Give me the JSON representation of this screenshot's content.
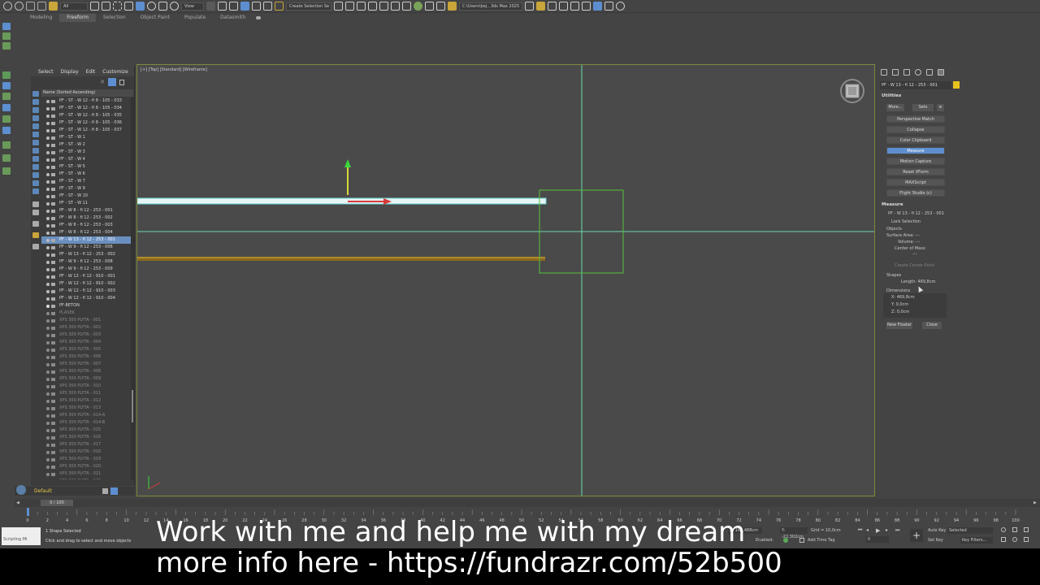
{
  "toolbar": {
    "selection_filter": "All",
    "view_dropdown": "View",
    "named_selection": "Create Selection Se",
    "project_path": "C:\\Users\\bej...3ds Max 2025"
  },
  "ribbon_tabs": [
    "Modeling",
    "Freeform",
    "Selection",
    "Object Paint",
    "Populate",
    "Datasmith"
  ],
  "ribbon_active": "Freeform",
  "explorer": {
    "menu": [
      "Select",
      "Display",
      "Edit",
      "Customize"
    ],
    "column_header": "Name (Sorted Ascending)",
    "rows": [
      {
        "name": "PF - ST - W 12 - fi 8 - 105 - 033",
        "state": "normal"
      },
      {
        "name": "PF - ST - W 12 - fi 8 - 105 - 034",
        "state": "normal"
      },
      {
        "name": "PF - ST - W 12 - fi 8 - 105 - 035",
        "state": "normal"
      },
      {
        "name": "PF - ST - W 12 - fi 8 - 105 - 036",
        "state": "normal"
      },
      {
        "name": "PF - ST - W 12 - fi 8 - 105 - 037",
        "state": "normal"
      },
      {
        "name": "PF - ST - W 1",
        "state": "normal"
      },
      {
        "name": "PF - ST - W 2",
        "state": "normal"
      },
      {
        "name": "PF - ST - W 3",
        "state": "normal"
      },
      {
        "name": "PF - ST - W 4",
        "state": "normal"
      },
      {
        "name": "PF - ST - W 5",
        "state": "normal"
      },
      {
        "name": "PF - ST - W 6",
        "state": "normal"
      },
      {
        "name": "PF - ST - W 7",
        "state": "normal"
      },
      {
        "name": "PF - ST - W 9",
        "state": "normal"
      },
      {
        "name": "PF - ST - W 10",
        "state": "normal"
      },
      {
        "name": "PF - ST - W 11",
        "state": "normal"
      },
      {
        "name": "PF - W 8 - fi 12 - 253 - 001",
        "state": "normal"
      },
      {
        "name": "PF - W 8 - fi 12 - 253 - 002",
        "state": "normal"
      },
      {
        "name": "PF - W 8 - fi 12 - 253 - 003",
        "state": "normal"
      },
      {
        "name": "PF - W 8 - fi 12 - 253 - 004",
        "state": "normal"
      },
      {
        "name": "PF - W 13 - fi 12 - 253 - 001",
        "state": "selected"
      },
      {
        "name": "PF - W 9 - fi 12 - 253 - 006",
        "state": "normal"
      },
      {
        "name": "PF - W 13 - fi 12 - 253 - 002",
        "state": "normal"
      },
      {
        "name": "PF - W 9 - fi 12 - 253 - 008",
        "state": "normal"
      },
      {
        "name": "PF - W 9 - fi 12 - 253 - 009",
        "state": "normal"
      },
      {
        "name": "PF - W 12 - fi 12 - 910 - 001",
        "state": "normal"
      },
      {
        "name": "PF - W 12 - fi 12 - 910 - 002",
        "state": "normal"
      },
      {
        "name": "PF - W 12 - fi 12 - 910 - 003",
        "state": "normal"
      },
      {
        "name": "PF - W 12 - fi 12 - 910 - 004",
        "state": "normal"
      },
      {
        "name": "PF-BETON",
        "state": "layer"
      },
      {
        "name": "PLASEK",
        "state": "dim"
      },
      {
        "name": "XPS 300 PLYTA - 001",
        "state": "dim"
      },
      {
        "name": "XPS 300 PLYTA - 002",
        "state": "dim"
      },
      {
        "name": "XPS 300 PLYTA - 003",
        "state": "dim"
      },
      {
        "name": "XPS 300 PLYTA - 004",
        "state": "dim"
      },
      {
        "name": "XPS 300 PLYTA - 005",
        "state": "dim"
      },
      {
        "name": "XPS 300 PLYTA - 006",
        "state": "dim"
      },
      {
        "name": "XPS 300 PLYTA - 007",
        "state": "dim"
      },
      {
        "name": "XPS 300 PLYTA - 008",
        "state": "dim"
      },
      {
        "name": "XPS 300 PLYTA - 009",
        "state": "dim"
      },
      {
        "name": "XPS 300 PLYTA - 010",
        "state": "dim"
      },
      {
        "name": "XPS 300 PLYTA - 011",
        "state": "dim"
      },
      {
        "name": "XPS 300 PLYTA - 012",
        "state": "dim"
      },
      {
        "name": "XPS 300 PLYTA - 013",
        "state": "dim"
      },
      {
        "name": "XPS 300 PLYTA - 014-A",
        "state": "dim"
      },
      {
        "name": "XPS 300 PLYTA - 014-B",
        "state": "dim"
      },
      {
        "name": "XPS 300 PLYTA - 015",
        "state": "dim"
      },
      {
        "name": "XPS 300 PLYTA - 016",
        "state": "dim"
      },
      {
        "name": "XPS 300 PLYTA - 017",
        "state": "dim"
      },
      {
        "name": "XPS 300 PLYTA - 018",
        "state": "dim"
      },
      {
        "name": "XPS 300 PLYTA - 019",
        "state": "dim"
      },
      {
        "name": "XPS 300 PLYTA - 020",
        "state": "dim"
      },
      {
        "name": "XPS 300 PLYTA - 021",
        "state": "dim"
      },
      {
        "name": "XPS 300 PLYTA - 022",
        "state": "dim"
      }
    ],
    "layer": "Default"
  },
  "viewport": {
    "label": "[+] [Top] [Standard] [Wireframe]"
  },
  "command_panel": {
    "object_name": "PF - W 13 - fi 12 - 253 - 001",
    "object_color": "#e8c21c",
    "utilities_title": "Utilities",
    "more_label": "More...",
    "sets_label": "Sets",
    "utility_buttons": [
      "Perspective Match",
      "Collapse",
      "Color Clipboard",
      "Measure",
      "Motion Capture",
      "Reset XForm",
      "MAXScript",
      "Flight Studio (c)"
    ],
    "active_utility": "Measure",
    "measure": {
      "title": "Measure",
      "object": "PF - W 13 - fi 12 - 253 - 001",
      "lock_selection": "Lock Selection",
      "objects_label": "Objects",
      "surface_area": "Surface Area: ---",
      "volume": "Volume: ---",
      "center_of_mass": "Center of Mass:",
      "center_value": "---",
      "create_center_point": "Create Center Point",
      "shapes_label": "Shapes",
      "length": "Length: 469,8cm",
      "dimensions_label": "Dimensions",
      "dim_x": "X:  469,8cm",
      "dim_y": "Y:  0,0cm",
      "dim_z": "Z:  0,0cm",
      "new_floater": "New Floater",
      "close": "Close"
    }
  },
  "timeline": {
    "frame": "0 / 100",
    "ticks": [
      "0",
      "2",
      "4",
      "6",
      "8",
      "10",
      "12",
      "14",
      "16",
      "18",
      "20",
      "22",
      "24",
      "26",
      "28",
      "30",
      "32",
      "34",
      "36",
      "38",
      "40",
      "42",
      "44",
      "46",
      "48",
      "50",
      "52",
      "54",
      "56",
      "58",
      "60",
      "62",
      "64",
      "66",
      "68",
      "70",
      "72",
      "74",
      "76",
      "78",
      "80",
      "82",
      "84",
      "86",
      "88",
      "90",
      "92",
      "94",
      "96",
      "98",
      "100"
    ]
  },
  "status": {
    "scripting": "Scripting Mi",
    "selected": "1 Shape Selected",
    "hint": "Click and drag to select and move objects",
    "x": "X: 160,488cm",
    "y": "Y: -22,302cm",
    "grid": "Grid = 10,0cm",
    "enabled": "Enabled:",
    "add_time_tag": "Add Time Tag",
    "auto_key": "Auto Key",
    "set_key": "Set Key",
    "selected_dd": "Selected",
    "key_filters": "Key Filters...",
    "frame_field": "0"
  },
  "overlay": {
    "line1": "Work with me and help me with my dream",
    "line2": "more info here - https://fundrazr.com/52b500"
  }
}
